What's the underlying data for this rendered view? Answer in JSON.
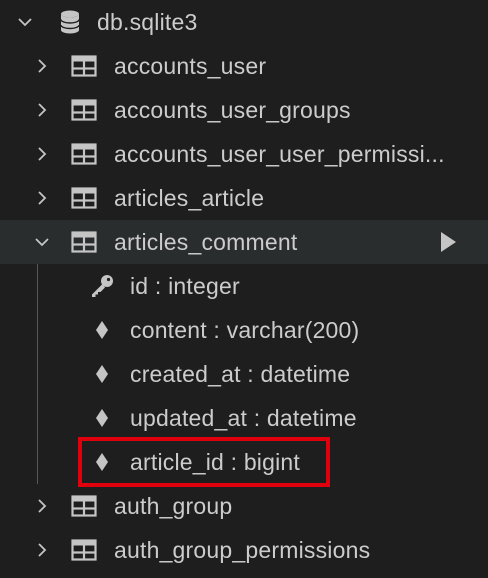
{
  "database": {
    "label": "db.sqlite3",
    "icon": "database-icon"
  },
  "tables": [
    {
      "label": "accounts_user",
      "icon": "table-icon",
      "expanded": false
    },
    {
      "label": "accounts_user_groups",
      "icon": "table-icon",
      "expanded": false
    },
    {
      "label": "accounts_user_user_permissi...",
      "icon": "table-icon",
      "expanded": false
    },
    {
      "label": "articles_article",
      "icon": "table-icon",
      "expanded": false
    },
    {
      "label": "articles_comment",
      "icon": "table-icon",
      "expanded": true
    },
    {
      "label": "auth_group",
      "icon": "table-icon",
      "expanded": false
    },
    {
      "label": "auth_group_permissions",
      "icon": "table-icon",
      "expanded": false
    }
  ],
  "columns": [
    {
      "label": "id : integer",
      "icon": "key-icon"
    },
    {
      "label": "content : varchar(200)",
      "icon": "diamond-icon"
    },
    {
      "label": "created_at : datetime",
      "icon": "diamond-icon"
    },
    {
      "label": "updated_at : datetime",
      "icon": "diamond-icon"
    },
    {
      "label": "article_id : bigint",
      "icon": "diamond-icon"
    }
  ],
  "actions": {
    "run_query_icon": "play-icon"
  },
  "colors": {
    "background": "#1e1e1e",
    "selected_row": "#2a2d2e",
    "text": "#cccccc",
    "highlight_border": "#e0000d"
  }
}
